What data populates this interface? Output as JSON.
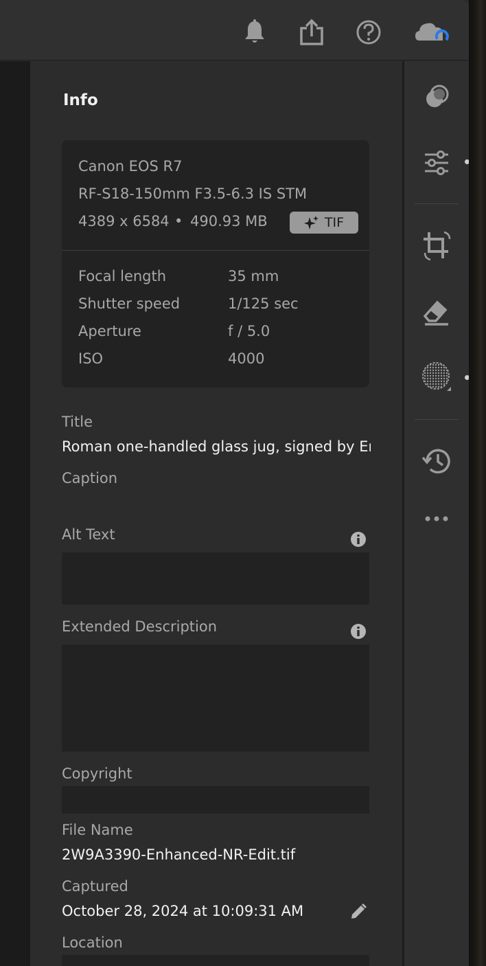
{
  "panel": {
    "title": "Info"
  },
  "camera": {
    "model": "Canon EOS R7",
    "lens": "RF-S18-150mm F3.5-6.3 IS STM",
    "dimensions": "4389 x 6584",
    "bullet": "•",
    "size": "490.93 MB",
    "format_badge": "TIF"
  },
  "exif": [
    {
      "label": "Focal length",
      "value": "35 mm"
    },
    {
      "label": "Shutter speed",
      "value": "1/125 sec"
    },
    {
      "label": "Aperture",
      "value": "f / 5.0"
    },
    {
      "label": "ISO",
      "value": "4000"
    }
  ],
  "fields": {
    "title_label": "Title",
    "title_value": "Roman one-handled glass jug, signed by En...",
    "caption_label": "Caption",
    "alt_label": "Alt Text",
    "alt_value": "",
    "extended_label": "Extended Description",
    "extended_value": "",
    "copyright_label": "Copyright",
    "copyright_value": "",
    "filename_label": "File Name",
    "filename_value": "2W9A3390-Enhanced-NR-Edit.tif",
    "captured_label": "Captured",
    "captured_value": "October 28, 2024 at 10:09:31 AM",
    "location_label": "Location"
  },
  "icons": {
    "topbar": [
      "bell-icon",
      "share-icon",
      "help-icon",
      "cloud-sync-icon"
    ],
    "tools": [
      "presets-icon",
      "edit-sliders-icon",
      "crop-icon",
      "healing-eraser-icon",
      "masking-icon",
      "versions-history-icon",
      "more-icon"
    ]
  },
  "colors": {
    "sync_accent": "#2d7be5",
    "panel_bg": "#2c2c2c",
    "card_bg": "#222222"
  }
}
